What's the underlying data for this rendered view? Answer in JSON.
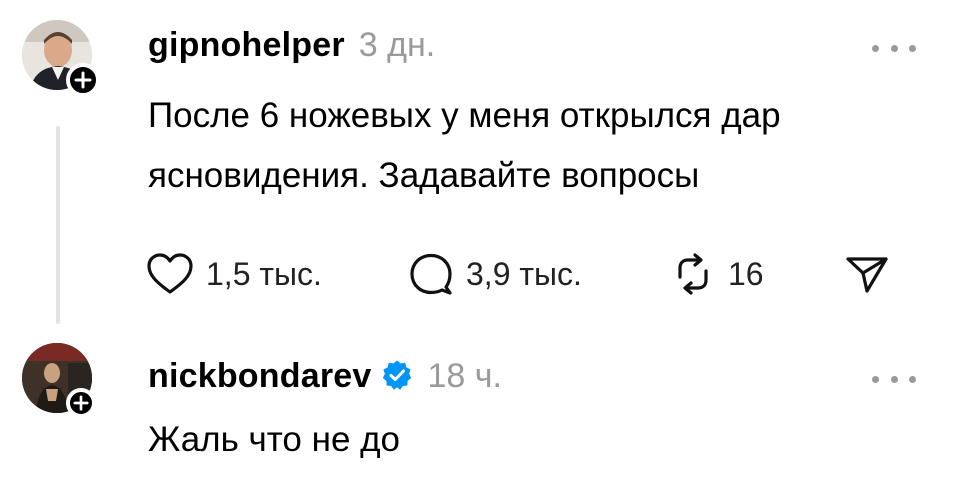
{
  "posts": [
    {
      "username": "gipnohelper",
      "time": "3 дн.",
      "text_line1": "После 6 ножевых у меня открылся дар",
      "text_line2": "ясновидения. Задавайте вопросы",
      "actions": {
        "likes": "1,5 тыс.",
        "comments": "3,9 тыс.",
        "reposts": "16"
      },
      "icons": [
        "avatar",
        "follow-plus-icon",
        "more-dots-icon",
        "heart-icon",
        "comment-bubble-icon",
        "repost-icon",
        "share-send-icon"
      ]
    },
    {
      "username": "nickbondarev",
      "verified": true,
      "time": "18 ч.",
      "text": "Жаль что не до",
      "icons": [
        "avatar",
        "follow-plus-icon",
        "verified-badge-icon",
        "more-dots-icon"
      ]
    }
  ],
  "colors": {
    "text": "#000000",
    "muted": "#9a9a9a",
    "verified": "#0095f6",
    "thread_line": "#e3e3e3"
  }
}
